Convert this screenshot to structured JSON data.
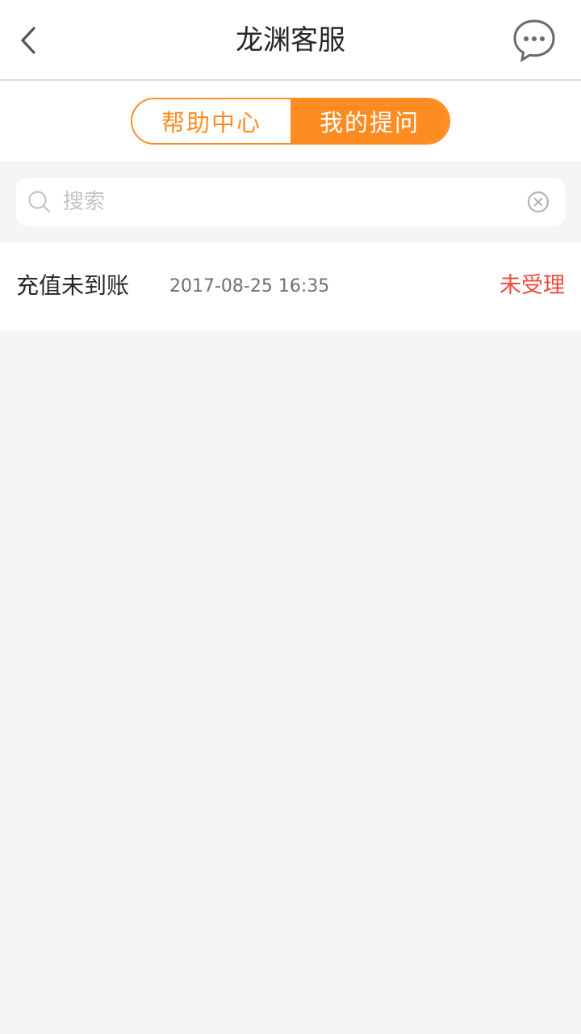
{
  "header": {
    "title": "龙渊客服",
    "back_icon": "chevron-left-icon",
    "chat_icon": "chat-bubble-icon"
  },
  "tabs": [
    {
      "label": "帮助中心",
      "active": false
    },
    {
      "label": "我的提问",
      "active": true
    }
  ],
  "search": {
    "placeholder": "搜索",
    "value": "",
    "search_icon": "search-icon",
    "clear_icon": "clear-icon"
  },
  "questions": [
    {
      "title": "充值未到账",
      "time": "2017-08-25 16:35",
      "status": "未受理"
    }
  ],
  "colors": {
    "accent": "#ff8c22",
    "status_pending": "#f04a3a",
    "background": "#f4f5f7"
  }
}
